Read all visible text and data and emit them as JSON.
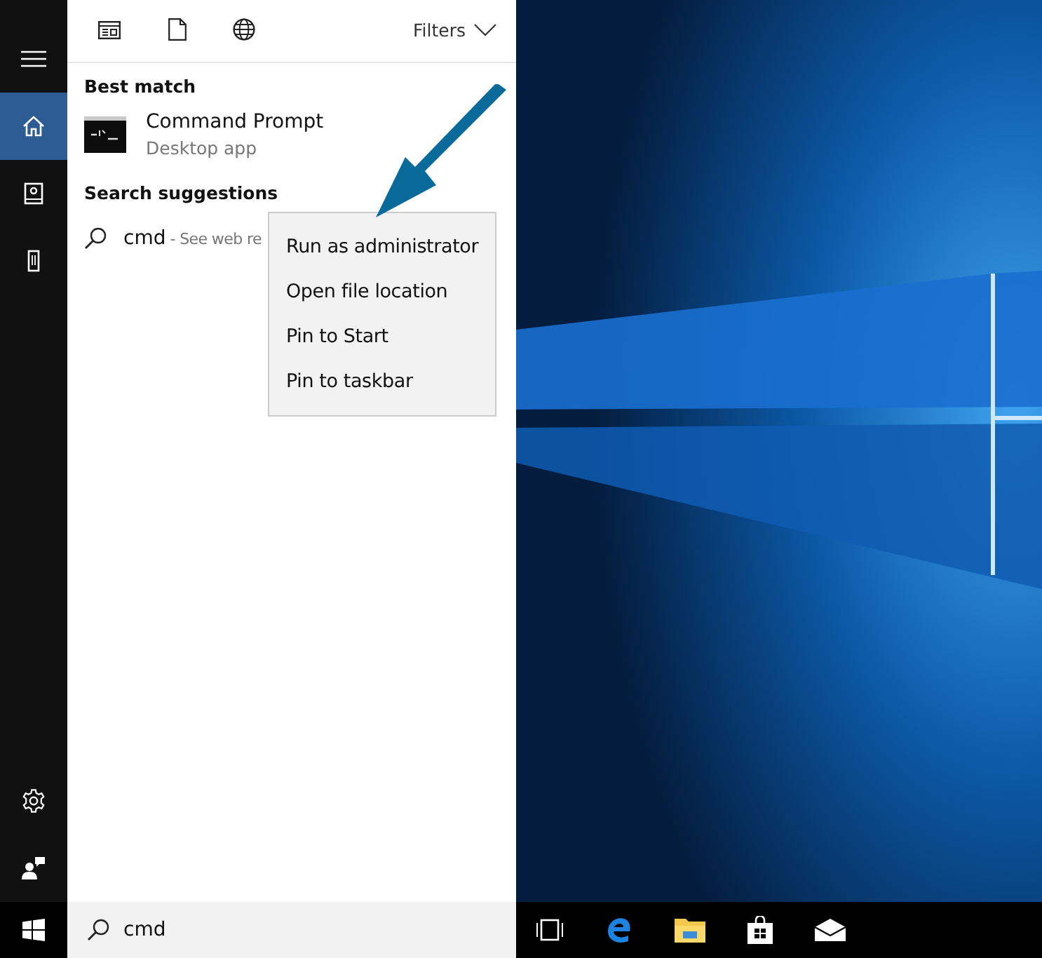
{
  "rail": {
    "items": [
      {
        "selected": true
      },
      {
        "selected": false
      },
      {
        "selected": false
      }
    ]
  },
  "search_panel": {
    "filters": "Filters",
    "best_match_heading": "Best match",
    "result": {
      "title": "Command Prompt",
      "subtitle": "Desktop app"
    },
    "suggestions_heading": "Search suggestions",
    "suggestion": {
      "query": "cmd",
      "hint": "- See web re"
    }
  },
  "context_menu": {
    "items": [
      "Run as administrator",
      "Open file location",
      "Pin to Start",
      "Pin to taskbar"
    ]
  },
  "taskbar": {
    "search_value": "cmd"
  }
}
